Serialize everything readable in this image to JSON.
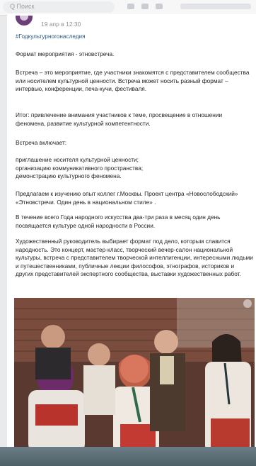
{
  "search": {
    "placeholder": "Q  Поиск"
  },
  "post": {
    "date": "19 апр в 12:30",
    "hashtag": "#Годкультурногонаследия",
    "paragraphs": [
      "Формат мероприятия - этновстреча.",
      "Встреча – это мероприятие, где участники знакомятся с представителем сообщества или носителем культурной ценности. Встреча может носить разный формат – интервью, конференции, печа-кучи, фестиваля.",
      "Итог: привлечение внимания участников к теме, просвещение в отношении феномена, развитие культурной компетентности.",
      "Встреча включает:",
      "приглашение носителя культурной ценности;\nорганизацию коммуникативного пространства;\nдемонстрацию культурного феномена.",
      "Предлагаем к изучению опыт коллег г.Москвы. Проект центра «Новослободский» «Этновстречи. Один день в национальном стиле» .",
      "В течение всего Года народного искусства два-три раза в месяц один день посвящается культуре одной народности в России.",
      "Художественный руководитель выбирает формат под дело, которым славится народность. Это концерт, мастер-класс, творческий вечер-салон национальной культуры, встреча с представителем творческой интеллигенции, интересными людьми и путешественниками, публичные лекции философов, этнографов, историков и других представителей экспертного сообщества, выставки художественных работ."
    ]
  },
  "icons": {
    "avatar": "community-avatar",
    "search": "search-icon"
  },
  "colors": {
    "link": "#2a5885",
    "text": "#222222",
    "meta": "#8a8f96"
  }
}
